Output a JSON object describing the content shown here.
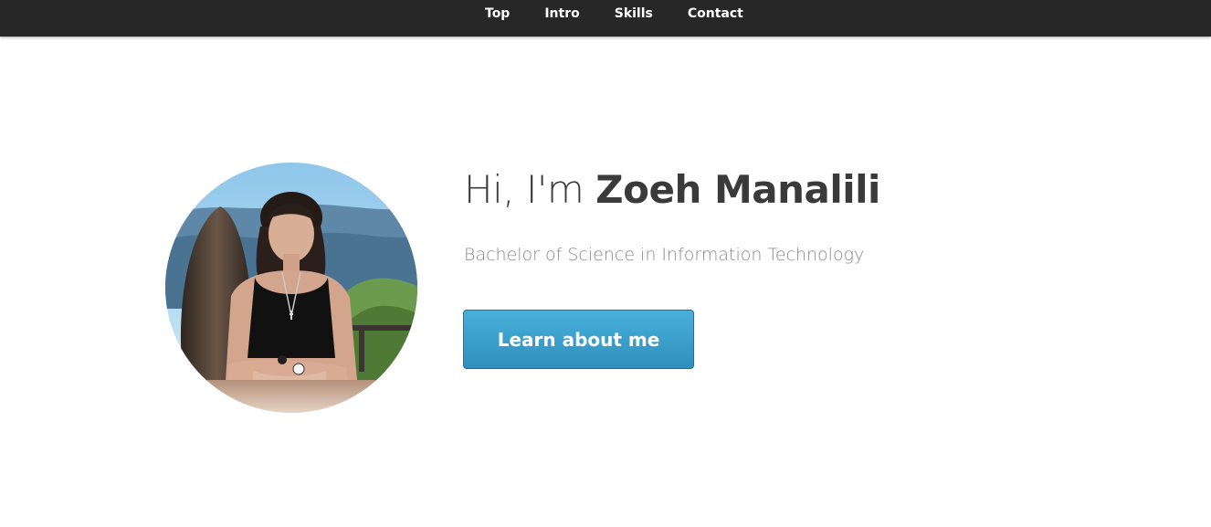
{
  "nav": {
    "items": [
      {
        "label": "Top"
      },
      {
        "label": "Intro"
      },
      {
        "label": "Skills"
      },
      {
        "label": "Contact"
      }
    ]
  },
  "hero": {
    "greeting": "Hi, I'm ",
    "name": "Zoeh Manalili",
    "subtitle": "Bachelor of Science in Information Technology",
    "cta_label": "Learn about me",
    "cta_color": "#3aa0cc"
  },
  "colors": {
    "nav_background": "#272727",
    "nav_text": "#ffffff",
    "title_text": "#3a3a3a",
    "subtitle_text": "#8a8a8a"
  },
  "icons": {
    "avatar": "profile-photo"
  }
}
